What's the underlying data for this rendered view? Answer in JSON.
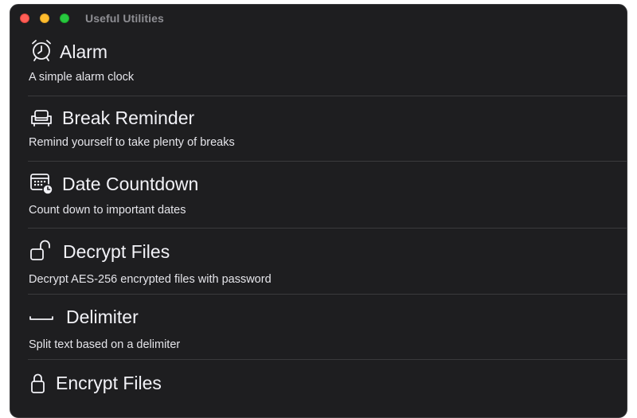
{
  "window": {
    "title": "Useful Utilities"
  },
  "utilities": [
    {
      "icon": "alarm-clock-icon",
      "title": "Alarm",
      "subtitle": "A simple alarm clock"
    },
    {
      "icon": "armchair-icon",
      "title": "Break Reminder",
      "subtitle": "Remind yourself to take plenty of breaks"
    },
    {
      "icon": "calendar-clock-icon",
      "title": "Date Countdown",
      "subtitle": "Count down to important dates"
    },
    {
      "icon": "lock-open-icon",
      "title": "Decrypt Files",
      "subtitle": "Decrypt AES-256 encrypted files with password"
    },
    {
      "icon": "space-bar-icon",
      "title": "Delimiter",
      "subtitle": "Split text based on a delimiter"
    },
    {
      "icon": "lock-closed-icon",
      "title": "Encrypt Files",
      "subtitle": ""
    }
  ],
  "colors": {
    "window_background": "#1e1e20",
    "divider": "#3a3a3c",
    "title_text": "#f2f2f7",
    "subtitle_text": "#e5e5ea",
    "titlebar_text": "#8e8e93",
    "close": "#ff5f57",
    "minimize": "#febc2e",
    "zoom": "#28c840"
  }
}
